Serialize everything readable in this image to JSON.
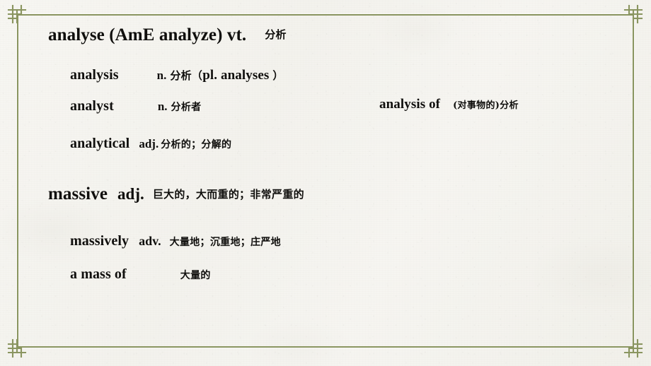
{
  "slide": {
    "background_color": "#f5f4f0",
    "frame_color": "#8a9560",
    "text_color": "#100f0d"
  },
  "entries": [
    {
      "id": "analyse",
      "headword": "analyse (AmE analyze) vt.",
      "pos": "",
      "gloss": "分析"
    },
    {
      "id": "analysis",
      "headword": "analysis",
      "pos": "n.",
      "gloss": "分析（",
      "gloss_extra": "pl.  analyses",
      "gloss_tail": "）"
    },
    {
      "id": "analyst",
      "headword": "analyst",
      "pos": "n.",
      "gloss": "分析者"
    },
    {
      "id": "analysis-of",
      "headword": "analysis of",
      "pos": "",
      "gloss": "(对事物的)分析"
    },
    {
      "id": "analytical",
      "headword": "analytical",
      "pos": "adj.",
      "gloss": "分析的；分解的"
    },
    {
      "id": "massive",
      "headword": "massive",
      "pos": "adj.",
      "gloss": "巨大的，大而重的；非常严重的"
    },
    {
      "id": "massively",
      "headword": "massively",
      "pos": "adv.",
      "gloss": "大量地；沉重地；庄严地"
    },
    {
      "id": "a-mass-of",
      "headword": "a mass of",
      "pos": "",
      "gloss": "大量的"
    }
  ],
  "ornaments": {
    "top_left": "chinese-knot-corner-icon",
    "top_right": "chinese-knot-corner-icon",
    "bottom_left": "chinese-knot-corner-icon",
    "bottom_right": "chinese-knot-corner-icon"
  }
}
